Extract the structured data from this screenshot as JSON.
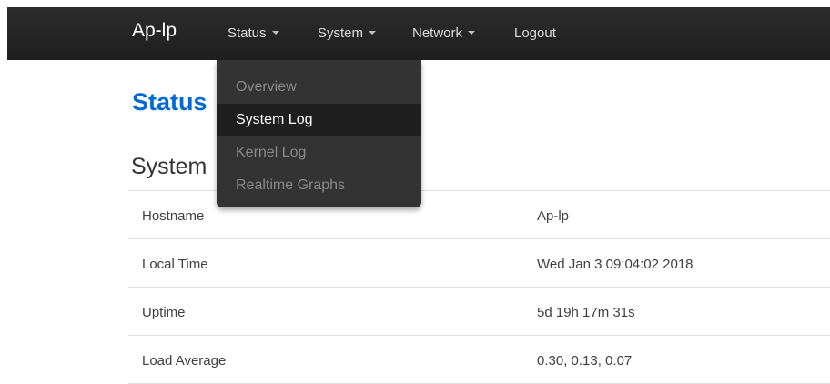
{
  "navbar": {
    "brand": "Ap-lp",
    "menus": [
      {
        "label": "Status",
        "has_caret": true
      },
      {
        "label": "System",
        "has_caret": true
      },
      {
        "label": "Network",
        "has_caret": true
      },
      {
        "label": "Logout",
        "has_caret": false
      }
    ],
    "status_dropdown": [
      {
        "label": "Overview",
        "active": false
      },
      {
        "label": "System Log",
        "active": true
      },
      {
        "label": "Kernel Log",
        "active": false
      },
      {
        "label": "Realtime Graphs",
        "active": false
      }
    ]
  },
  "main": {
    "title": "Status",
    "section_title": "System",
    "rows": [
      {
        "label": "Hostname",
        "value": "Ap-lp"
      },
      {
        "label": "Local Time",
        "value": "Wed Jan 3 09:04:02 2018"
      },
      {
        "label": "Uptime",
        "value": "5d 19h 17m 31s"
      },
      {
        "label": "Load Average",
        "value": "0.30, 0.13, 0.07"
      }
    ]
  },
  "colors": {
    "navbar_bg": "#222222",
    "title_blue": "#0069d6",
    "dropdown_bg": "#333333",
    "dropdown_active_bg": "#1f1f1f"
  }
}
